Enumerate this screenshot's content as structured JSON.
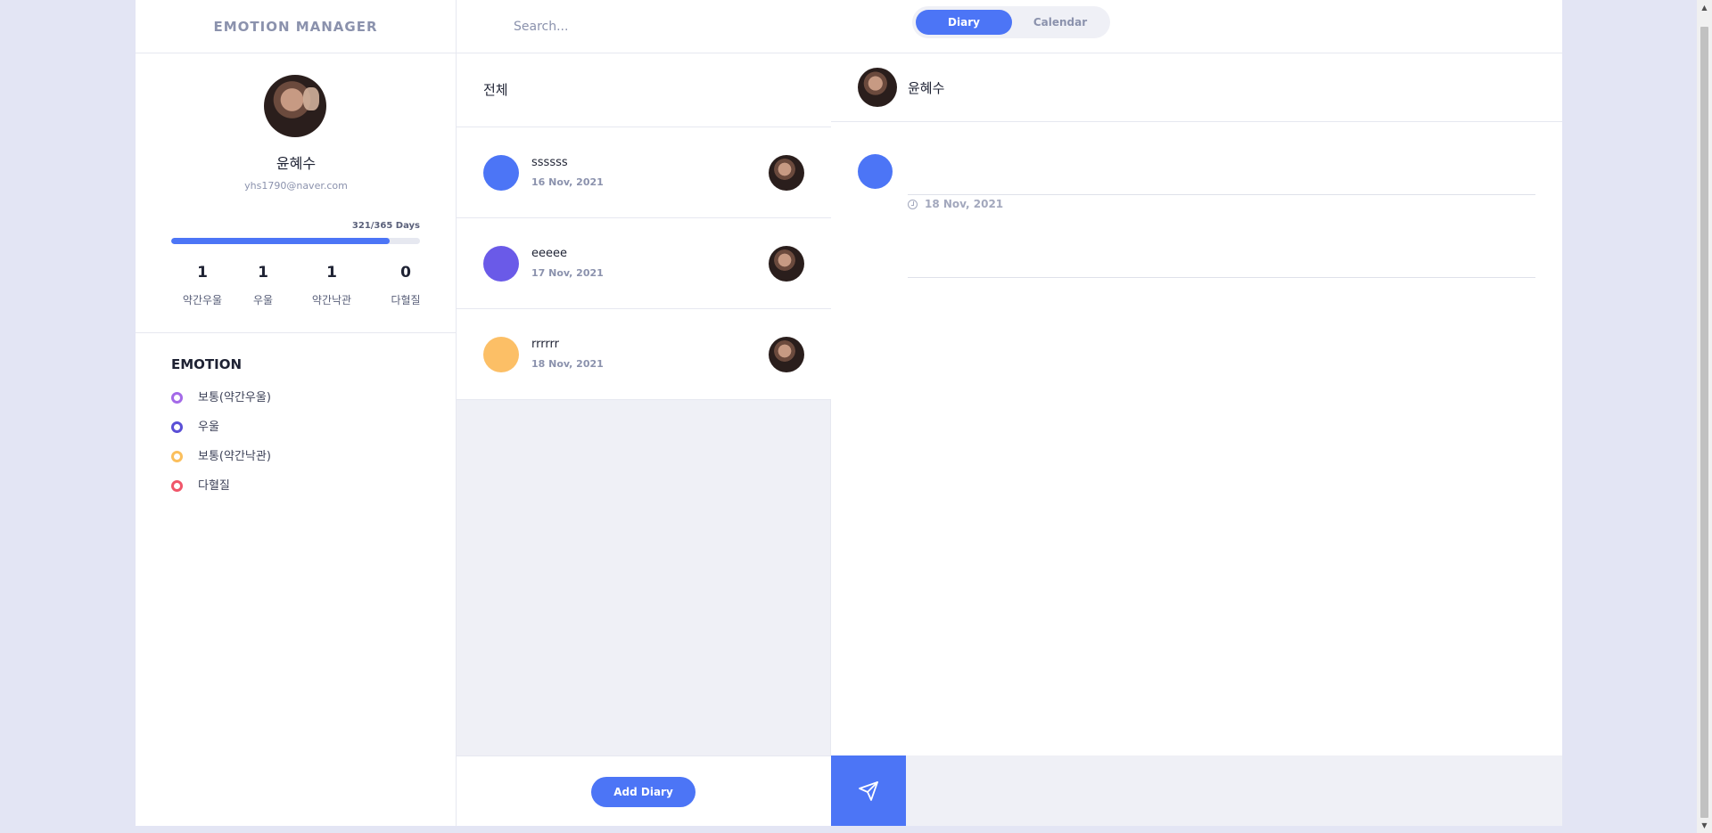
{
  "header": {
    "brand": "EMOTION MANAGER",
    "search_placeholder": "Search...",
    "tabs": [
      {
        "label": "Diary",
        "active": true
      },
      {
        "label": "Calendar",
        "active": false
      }
    ]
  },
  "profile": {
    "name": "윤혜수",
    "email": "yhs1790@naver.com",
    "days_label": "321/365 Days",
    "progress_fraction": 0.879,
    "stats": [
      {
        "value": "1",
        "label": "약간우울"
      },
      {
        "value": "1",
        "label": "우울"
      },
      {
        "value": "1",
        "label": "약간낙관"
      },
      {
        "value": "0",
        "label": "다혈질"
      }
    ]
  },
  "emotions": {
    "title": "EMOTION",
    "items": [
      {
        "label": "보통(약간우울)",
        "color": "#a46ae8"
      },
      {
        "label": "우울",
        "color": "#5a4fd6"
      },
      {
        "label": "보통(약간낙관)",
        "color": "#fbbf5c"
      },
      {
        "label": "다혈질",
        "color": "#f0566a"
      }
    ]
  },
  "list": {
    "header": "전체",
    "entries": [
      {
        "title": "ssssss",
        "date": "16 Nov, 2021",
        "color": "#4c75f6"
      },
      {
        "title": "eeeee",
        "date": "17 Nov, 2021",
        "color": "#6a5ae8"
      },
      {
        "title": "rrrrrr",
        "date": "18 Nov, 2021",
        "color": "#fcbf66"
      }
    ],
    "add_button": "Add Diary"
  },
  "detail": {
    "author": "윤혜수",
    "date": "18 Nov, 2021",
    "dot_color": "#4c75f6"
  },
  "icons": {
    "send": "send-icon",
    "clock": "clock-icon",
    "avatar": "avatar"
  }
}
